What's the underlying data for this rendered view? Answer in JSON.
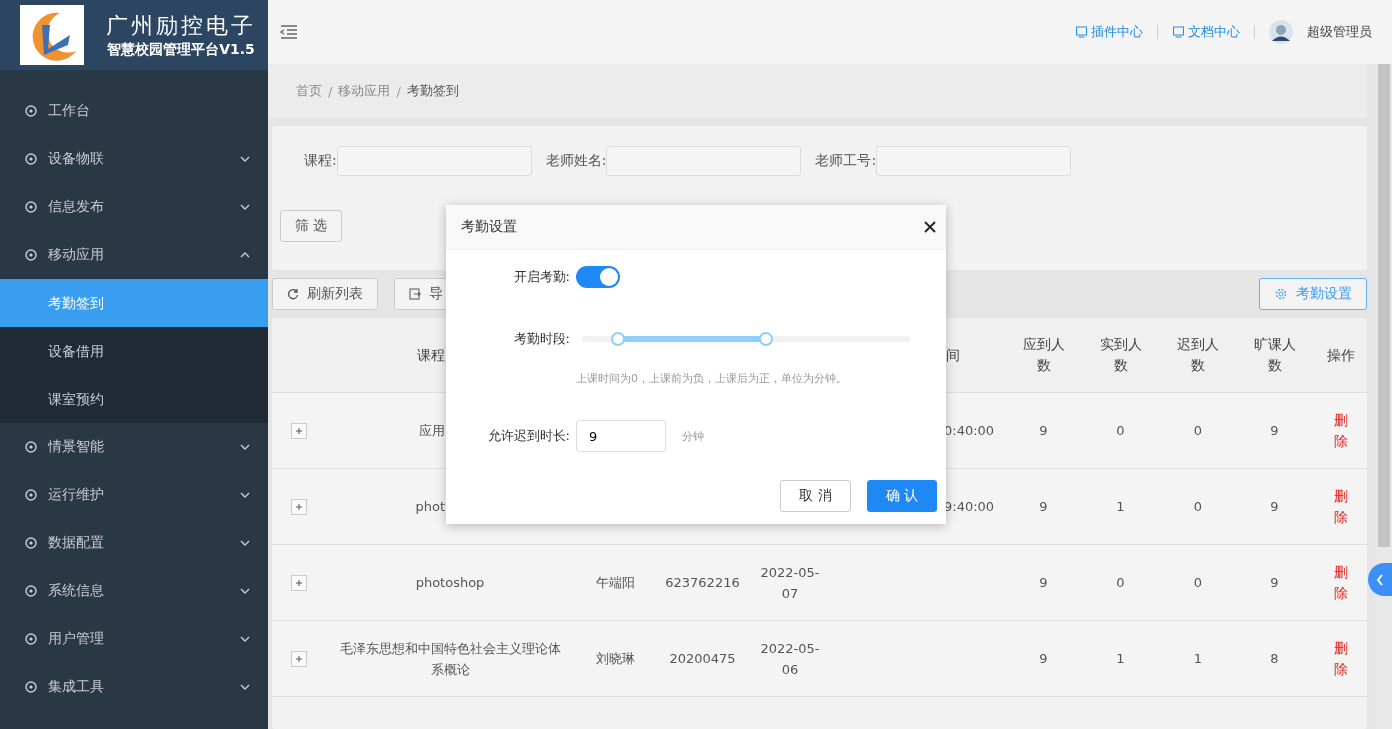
{
  "sidebar": {
    "company": "广州励控电子",
    "product": "智慧校园管理平台V1.5",
    "items": [
      {
        "label": "工作台",
        "selected": false
      },
      {
        "label": "设备物联",
        "expanded": false,
        "selected": false
      },
      {
        "label": "信息发布",
        "expanded": false,
        "selected": false
      },
      {
        "label": "移动应用",
        "expanded": true,
        "selected": false,
        "children": [
          {
            "label": "考勤签到",
            "selected": true
          },
          {
            "label": "设备借用",
            "selected": false
          },
          {
            "label": "课室预约",
            "selected": false
          }
        ]
      },
      {
        "label": "情景智能",
        "expanded": false,
        "selected": false
      },
      {
        "label": "运行维护",
        "expanded": false,
        "selected": false
      },
      {
        "label": "数据配置",
        "expanded": false,
        "selected": false
      },
      {
        "label": "系统信息",
        "expanded": false,
        "selected": false
      },
      {
        "label": "用户管理",
        "expanded": false,
        "selected": false
      },
      {
        "label": "集成工具",
        "expanded": false,
        "selected": false
      }
    ]
  },
  "header": {
    "links": [
      "插件中心",
      "文档中心"
    ],
    "user": "超级管理员"
  },
  "breadcrumb": [
    "首页",
    "移动应用",
    "考勤签到"
  ],
  "breadcrumb_separator": "/",
  "filters": [
    {
      "label": "课程:"
    },
    {
      "label": "老师姓名:"
    },
    {
      "label": "老师工号:"
    }
  ],
  "filter_button": "筛 选",
  "toolbar": {
    "buttons": [
      "刷新列表",
      "导"
    ],
    "settings_button": "考勤设置"
  },
  "table": {
    "columns": [
      {},
      {
        "label": "课程"
      },
      {},
      {},
      {},
      {
        "label": "间"
      },
      {
        "label": "应到人数"
      },
      {
        "label": "实到人数"
      },
      {
        "label": "迟到人数"
      },
      {
        "label": "旷课人数"
      },
      {
        "label": "操作"
      }
    ],
    "rows": [
      {
        "course": "应用",
        "time": "0:40:00",
        "expected": "9",
        "present": "0",
        "late": "0",
        "absent": "9",
        "action": "删除"
      },
      {
        "course": "phot",
        "time": "9:40:00",
        "expected": "9",
        "present": "1",
        "late": "0",
        "absent": "9",
        "action": "删除"
      },
      {
        "course": "photoshop",
        "teacher": "午端阳",
        "staff_id": "623762216",
        "date": "2022-05-07",
        "expected": "9",
        "present": "0",
        "late": "0",
        "absent": "9",
        "action": "删除"
      },
      {
        "course": "毛泽东思想和中国特色社会主义理论体系概论",
        "teacher": "刘晓琳",
        "staff_id": "20200475",
        "date": "2022-05-06",
        "expected": "9",
        "present": "1",
        "late": "1",
        "absent": "8",
        "action": "删除"
      }
    ]
  },
  "dialog": {
    "title": "考勤设置",
    "enable_label": "开启考勤:",
    "enabled": true,
    "period_label": "考勤时段:",
    "thumbs": [
      {
        "level": 0.11
      },
      {
        "level": 0.56
      }
    ],
    "hint": "上课时间为0，上课前为负，上课后为正，单位为分钟。",
    "late_label": "允许迟到时长:",
    "late_value": "9",
    "late_unit": "分钟",
    "cancel": "取 消",
    "confirm": "确 认"
  }
}
